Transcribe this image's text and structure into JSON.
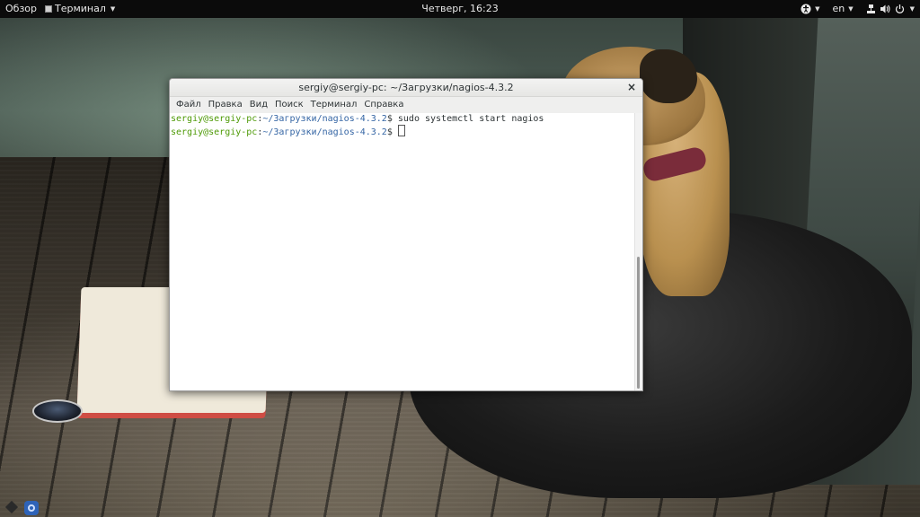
{
  "topbar": {
    "activities": "Обзор",
    "app_menu": "Терминал",
    "clock": "Четверг, 16:23",
    "language": "en"
  },
  "icons": {
    "accessibility": "accessibility-icon",
    "network": "network-icon",
    "volume": "volume-icon",
    "power": "power-icon",
    "close": "close-icon"
  },
  "terminal": {
    "title": "sergiy@sergiy-pc: ~/Загрузки/nagios-4.3.2",
    "menu": [
      "Файл",
      "Правка",
      "Вид",
      "Поиск",
      "Терминал",
      "Справка"
    ],
    "lines": [
      {
        "user": "sergiy@sergiy-pc",
        "sep": ":",
        "path": "~/Загрузки/nagios-4.3.2",
        "prompt": "$",
        "command": " sudo systemctl start nagios"
      },
      {
        "user": "sergiy@sergiy-pc",
        "sep": ":",
        "path": "~/Загрузки/nagios-4.3.2",
        "prompt": "$",
        "command": " "
      }
    ]
  },
  "colors": {
    "prompt_user": "#4e9a06",
    "prompt_path": "#3465a4",
    "topbar_bg": "#0b0b0b"
  }
}
